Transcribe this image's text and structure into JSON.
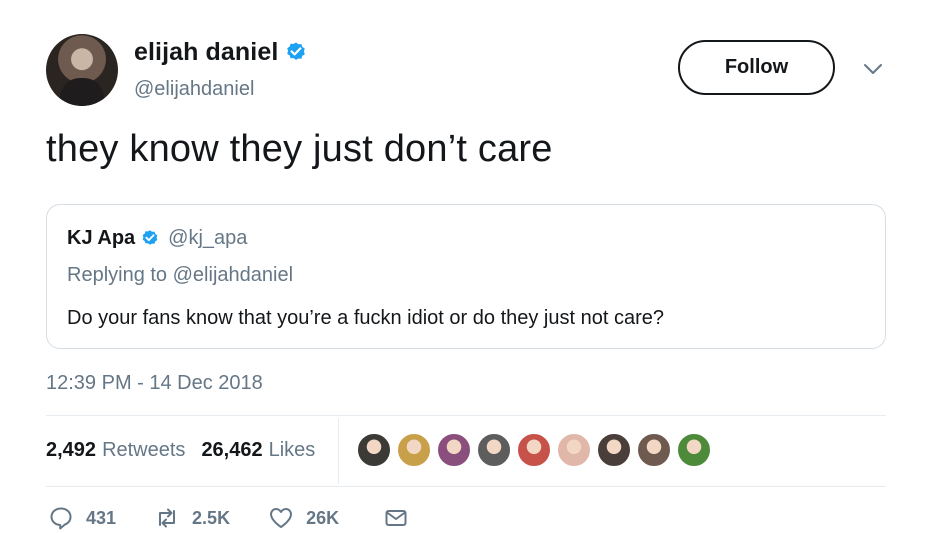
{
  "author": {
    "name": "elijah daniel",
    "handle": "@elijahdaniel",
    "verified": true,
    "avatar_icon": "avatar-photo"
  },
  "follow_button": {
    "label": "Follow"
  },
  "caret_icon": "chevron-down-icon",
  "tweet": {
    "text": "they know they just don’t care",
    "timestamp": "12:39 PM - 14 Dec 2018"
  },
  "quoted": {
    "name": "KJ Apa",
    "handle": "@kj_apa",
    "verified": true,
    "replying_prefix": "Replying to",
    "replying_handle": "@elijahdaniel",
    "text": "Do your fans know that you’re a fuckn idiot or do they just not care?"
  },
  "stats": {
    "retweets_count": "2,492",
    "retweets_label": "Retweets",
    "likes_count": "26,462",
    "likes_label": "Likes"
  },
  "likers": [
    {
      "name": "liker-avatar-1",
      "color": "#3b3a36"
    },
    {
      "name": "liker-avatar-2",
      "color": "#c9a04a"
    },
    {
      "name": "liker-avatar-3",
      "color": "#8a4f7d"
    },
    {
      "name": "liker-avatar-4",
      "color": "#5d5d5d"
    },
    {
      "name": "liker-avatar-5",
      "color": "#c7524a"
    },
    {
      "name": "liker-avatar-6",
      "color": "#e0b7a8"
    },
    {
      "name": "liker-avatar-7",
      "color": "#4a3e3a"
    },
    {
      "name": "liker-avatar-8",
      "color": "#6f5a50"
    },
    {
      "name": "liker-avatar-9",
      "color": "#4d8a3a"
    }
  ],
  "actions": {
    "reply_count": "431",
    "retweet_count": "2.5K",
    "like_count": "26K"
  },
  "colors": {
    "verified_blue": "#1da1f2",
    "secondary_text": "#657786",
    "primary_text": "#14171a"
  }
}
